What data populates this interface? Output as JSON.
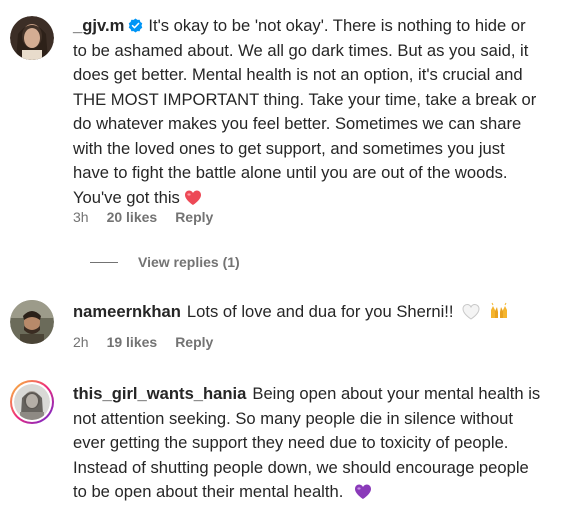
{
  "comments": [
    {
      "username": "_gjv.m",
      "verified": true,
      "lines": [
        "It's okay to be 'not okay'. There is nothing to hide or",
        "to be ashamed about. We all go dark times. But as you said, it",
        "does get better. Mental health is not an option, it's crucial and",
        "THE MOST IMPORTANT thing. Take your time, take a break or",
        "do whatever makes you feel better. Sometimes we can share",
        "with the loved ones to get support, and sometimes you just",
        "have to fight the battle alone until you are out of the woods.",
        "You've got this"
      ],
      "emoji": "red-heart-icon",
      "time": "3h",
      "likes": "20 likes",
      "reply": "Reply",
      "view_replies": "View replies (1)"
    },
    {
      "username": "nameernkhan",
      "text": "Lots of love and dua for you Sherni!!",
      "emojis": [
        "white-heart-icon",
        "raising-hands-icon"
      ],
      "time": "2h",
      "likes": "19 likes",
      "reply": "Reply"
    },
    {
      "username": "this_girl_wants_hania",
      "lines": [
        "Being open about your mental health is",
        "not attention seeking. So many people die in silence without",
        "ever getting the support they need due to toxicity of people.",
        "Instead of shutting people down, we should encourage people",
        "to be open about their mental health."
      ],
      "emoji": "purple-heart-icon"
    }
  ],
  "colors": {
    "text": "#262626",
    "meta": "#737373",
    "verified": "#0095f6",
    "heart_red": "#ed4956"
  }
}
